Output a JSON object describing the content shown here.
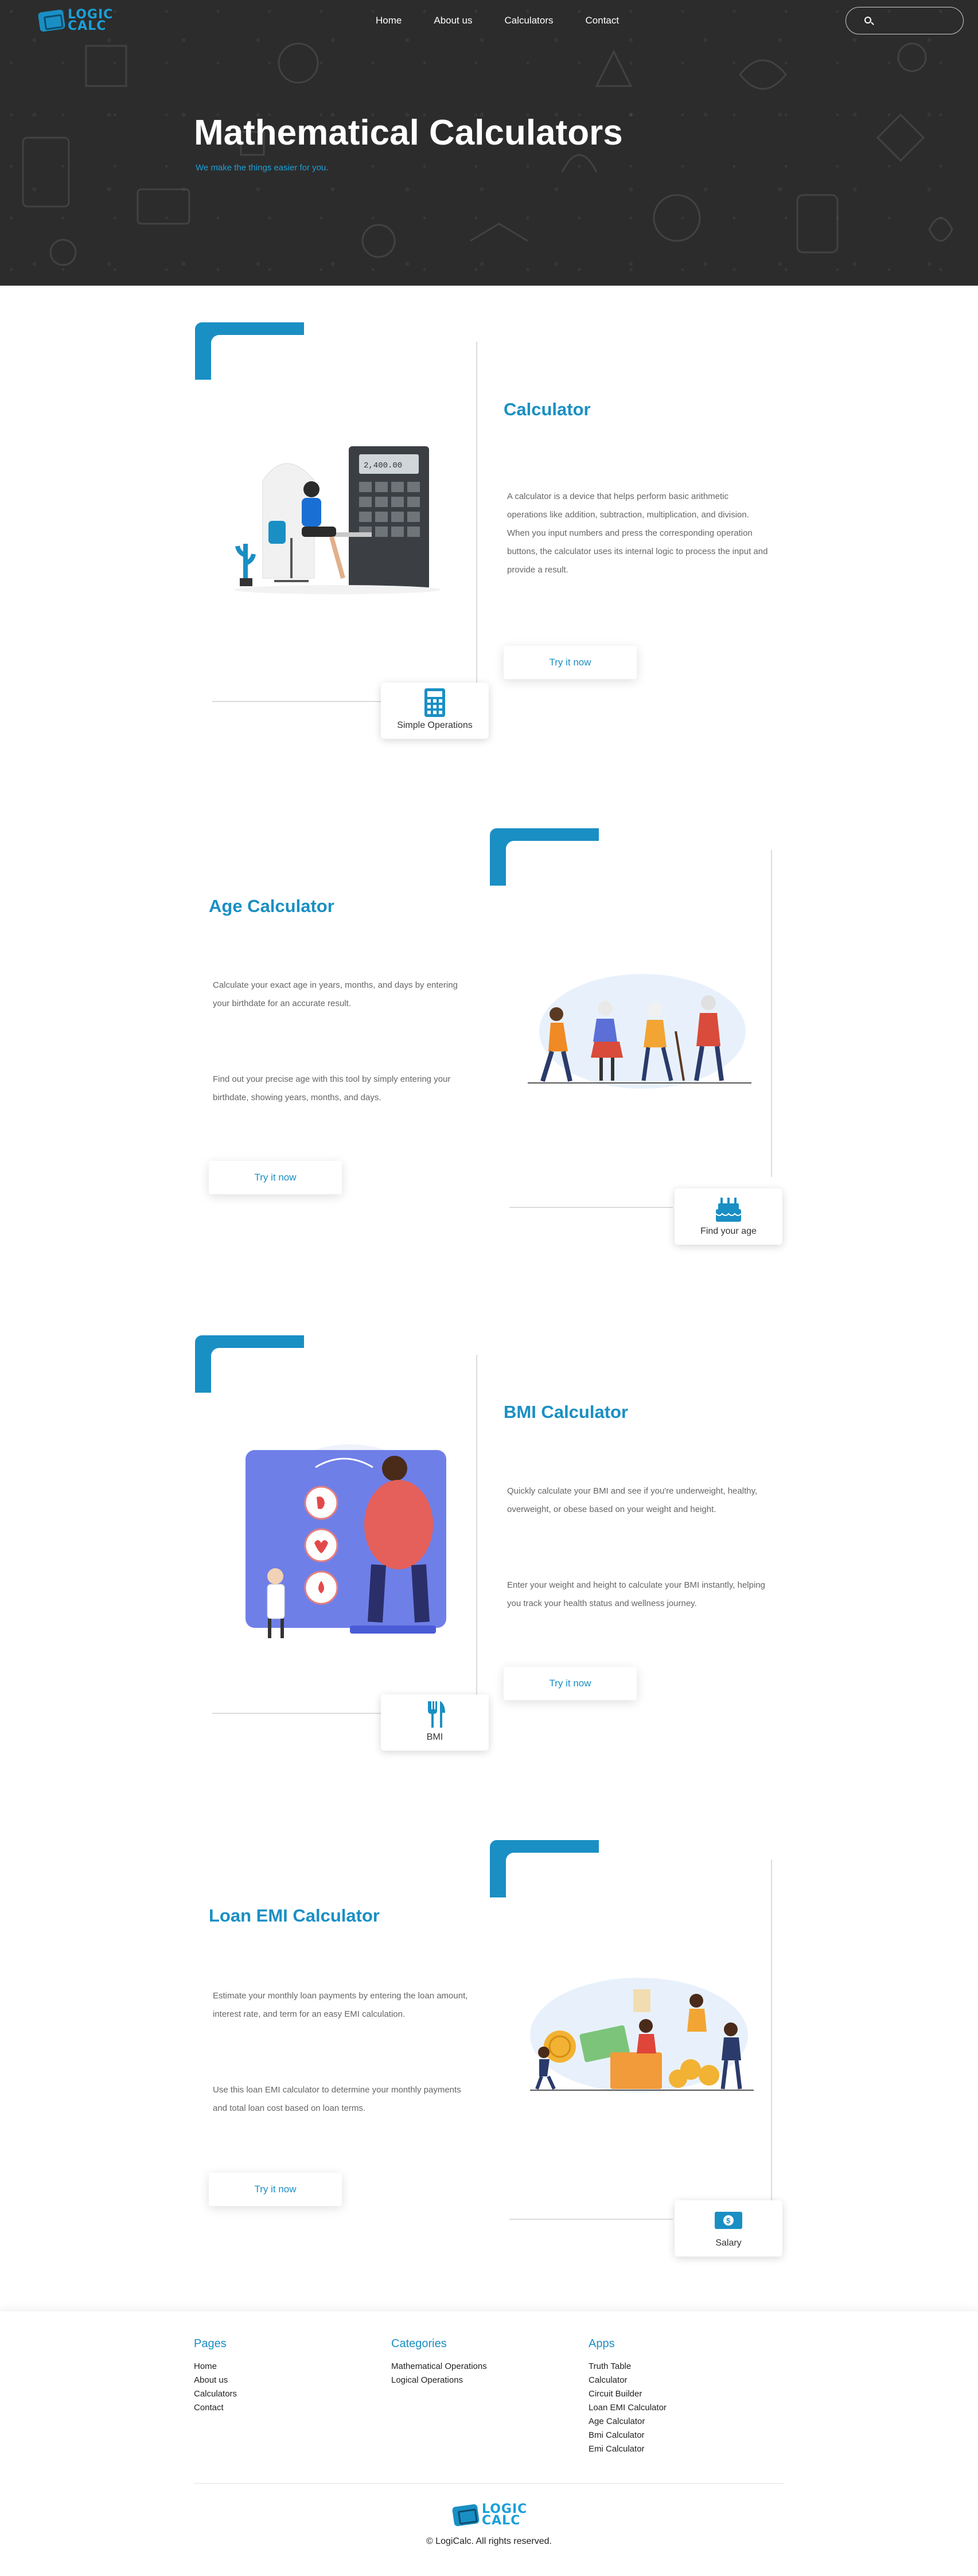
{
  "brand": {
    "line1": "LOGIC",
    "line2": "CALC"
  },
  "nav": {
    "items": [
      "Home",
      "About us",
      "Calculators",
      "Contact"
    ]
  },
  "hero": {
    "title": "Mathematical Calculators",
    "subtitle": "We make the things easier for you."
  },
  "sections": [
    {
      "title": "Calculator",
      "paragraphs": [
        "A calculator is a device that helps perform basic arithmetic operations like addition, subtraction, multiplication, and division. When you input numbers and press the corresponding operation buttons, the calculator uses its internal logic to process the input and provide a result."
      ],
      "button": "Try it now",
      "badge": "Simple Operations",
      "display_value": "2,400.00"
    },
    {
      "title": "Age Calculator",
      "paragraphs": [
        "Calculate your exact age in years, months, and days by entering your birthdate for an accurate result.",
        "Find out your precise age with this tool by simply entering your birthdate, showing years, months, and days."
      ],
      "button": "Try it now",
      "badge": "Find your age"
    },
    {
      "title": "BMI Calculator",
      "paragraphs": [
        "Quickly calculate your BMI and see if you're underweight, healthy, overweight, or obese based on your weight and height.",
        "Enter your weight and height to calculate your BMI instantly, helping you track your health status and wellness journey."
      ],
      "button": "Try it now",
      "badge": "BMI"
    },
    {
      "title": "Loan EMI Calculator",
      "paragraphs": [
        "Estimate your monthly loan payments by entering the loan amount, interest rate, and term for an easy EMI calculation.",
        "Use this loan EMI calculator to determine your monthly payments and total loan cost based on loan terms."
      ],
      "button": "Try it now",
      "badge": "Salary"
    }
  ],
  "footer": {
    "pages": {
      "title": "Pages",
      "links": [
        "Home",
        "About us",
        "Calculators",
        "Contact"
      ]
    },
    "categories": {
      "title": "Categories",
      "links": [
        "Mathematical Operations",
        "Logical Operations"
      ]
    },
    "apps": {
      "title": "Apps",
      "links": [
        "Truth Table",
        "Calculator",
        "Circuit Builder",
        "Loan EMI Calculator",
        "Age Calculator",
        "Bmi Calculator",
        "Emi Calculator"
      ]
    },
    "copyright": "© LogiCalc. All rights reserved."
  },
  "colors": {
    "accent": "#1a8fc4",
    "hero_bg": "#2c2c2c",
    "text_muted": "#666666"
  }
}
